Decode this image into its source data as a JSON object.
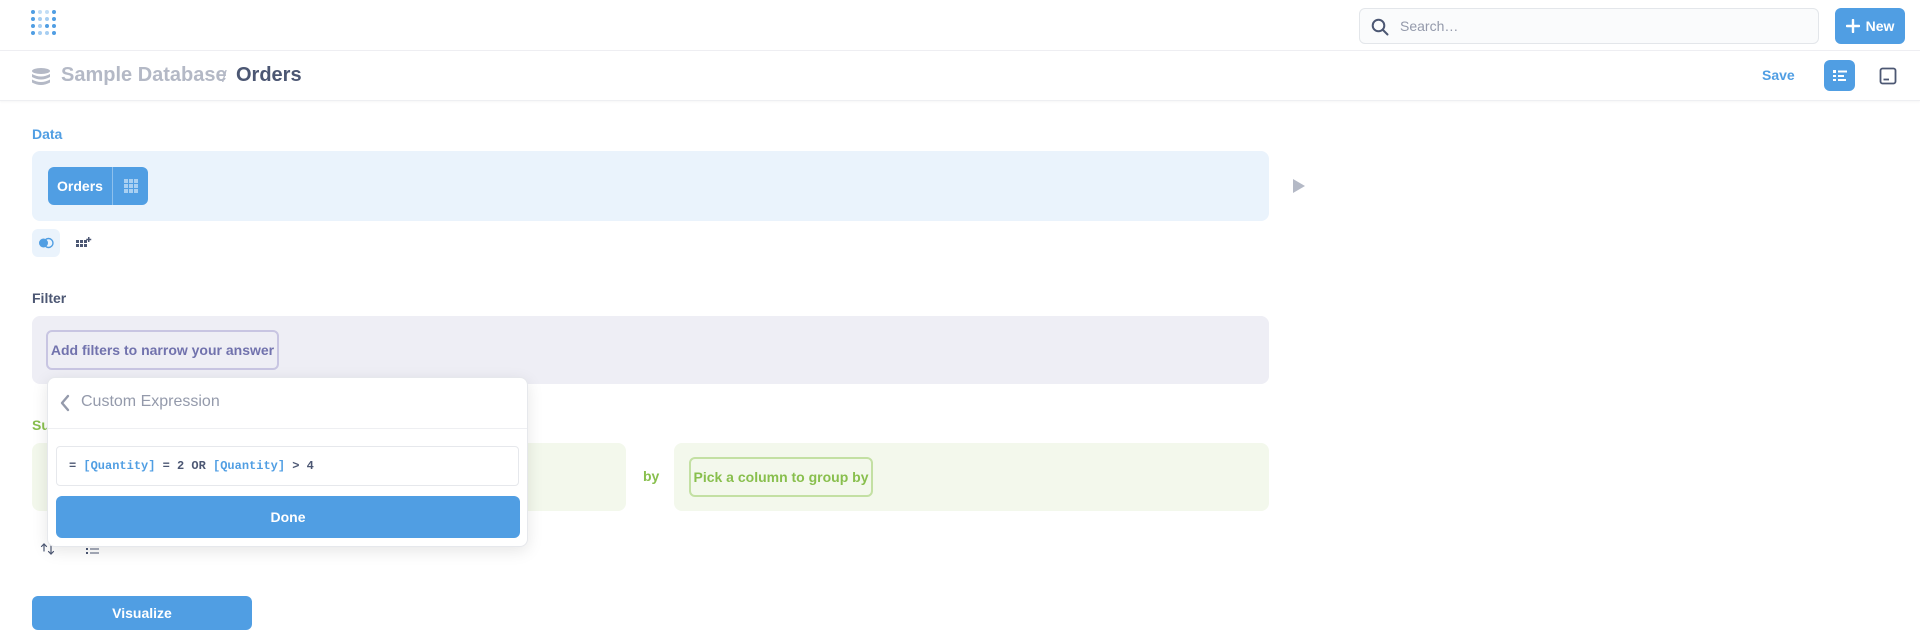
{
  "nav": {
    "search_placeholder": "Search…",
    "new_label": "New"
  },
  "header": {
    "breadcrumb_db": "Sample Database",
    "breadcrumb_sep": "/",
    "breadcrumb_table": "Orders",
    "save_label": "Save"
  },
  "data_step": {
    "title": "Data",
    "table_label": "Orders"
  },
  "filter_step": {
    "title": "Filter",
    "pill_label": "Add filters to narrow your answer"
  },
  "summarize_step": {
    "title_visible": "Su",
    "by_label": "by",
    "group_by_label": "Pick a column to group by"
  },
  "popover": {
    "title": "Custom Expression",
    "expression": {
      "prefix": "= ",
      "field1": "[Quantity]",
      "mid1": " = 2 OR ",
      "field2": "[Quantity]",
      "suffix": " > 4"
    },
    "done_label": "Done"
  },
  "visualize_label": "Visualize",
  "colors": {
    "brand": "#509ee3",
    "filter": "#7172ad",
    "summarize": "#88bf4d"
  },
  "icons": {
    "logo": "metabase-logo-icon",
    "search": "search-icon",
    "new": "plus-icon",
    "db": "database-icon",
    "notebook": "notebook-icon",
    "console": "console-icon",
    "grid": "grid-icon",
    "run": "play-icon",
    "join": "join-icon",
    "columns": "custom-column-icon",
    "sort": "sort-icon",
    "limit": "limit-icon",
    "back": "chevron-left-icon"
  }
}
